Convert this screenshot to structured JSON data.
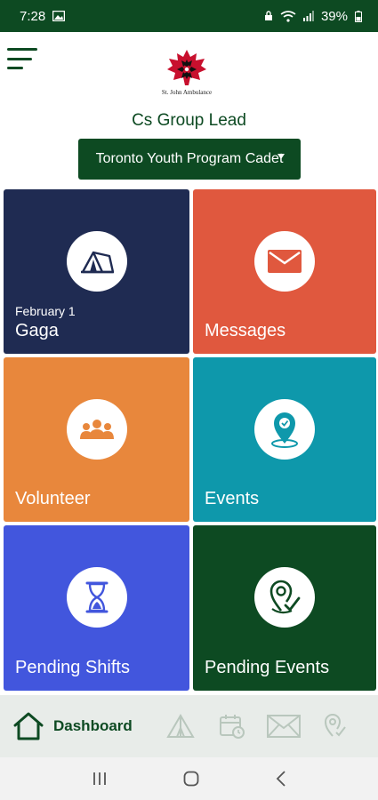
{
  "status_bar": {
    "time": "7:28",
    "battery": "39%",
    "icons": [
      "gallery-icon",
      "lock-icon",
      "wifi-icon",
      "signal-icon",
      "battery-icon"
    ]
  },
  "header": {
    "logo_caption": "St. John Ambulance",
    "group_title": "Cs Group Lead",
    "program_selected": "Toronto Youth Program Cadet"
  },
  "tiles": [
    {
      "label": "Gaga",
      "sub": "February 1",
      "icon": "tent-icon",
      "color": "#1f2b52"
    },
    {
      "label": "Messages",
      "icon": "envelope-icon",
      "color": "#e0583e"
    },
    {
      "label": "Volunteer",
      "icon": "group-icon",
      "color": "#e8873c"
    },
    {
      "label": "Events",
      "icon": "map-pin-icon",
      "color": "#0e98ab"
    },
    {
      "label": "Pending Shifts",
      "icon": "hourglass-icon",
      "color": "#4256dd"
    },
    {
      "label": "Pending Events",
      "icon": "location-check-icon",
      "color": "#0d4a22"
    }
  ],
  "bottom_nav": {
    "active_label": "Dashboard",
    "items": [
      "home-icon",
      "tent-icon",
      "calendar-icon",
      "envelope-icon",
      "location-icon"
    ]
  },
  "colors": {
    "brand_green": "#0d4a22",
    "inactive_nav": "#b9c7bd"
  }
}
